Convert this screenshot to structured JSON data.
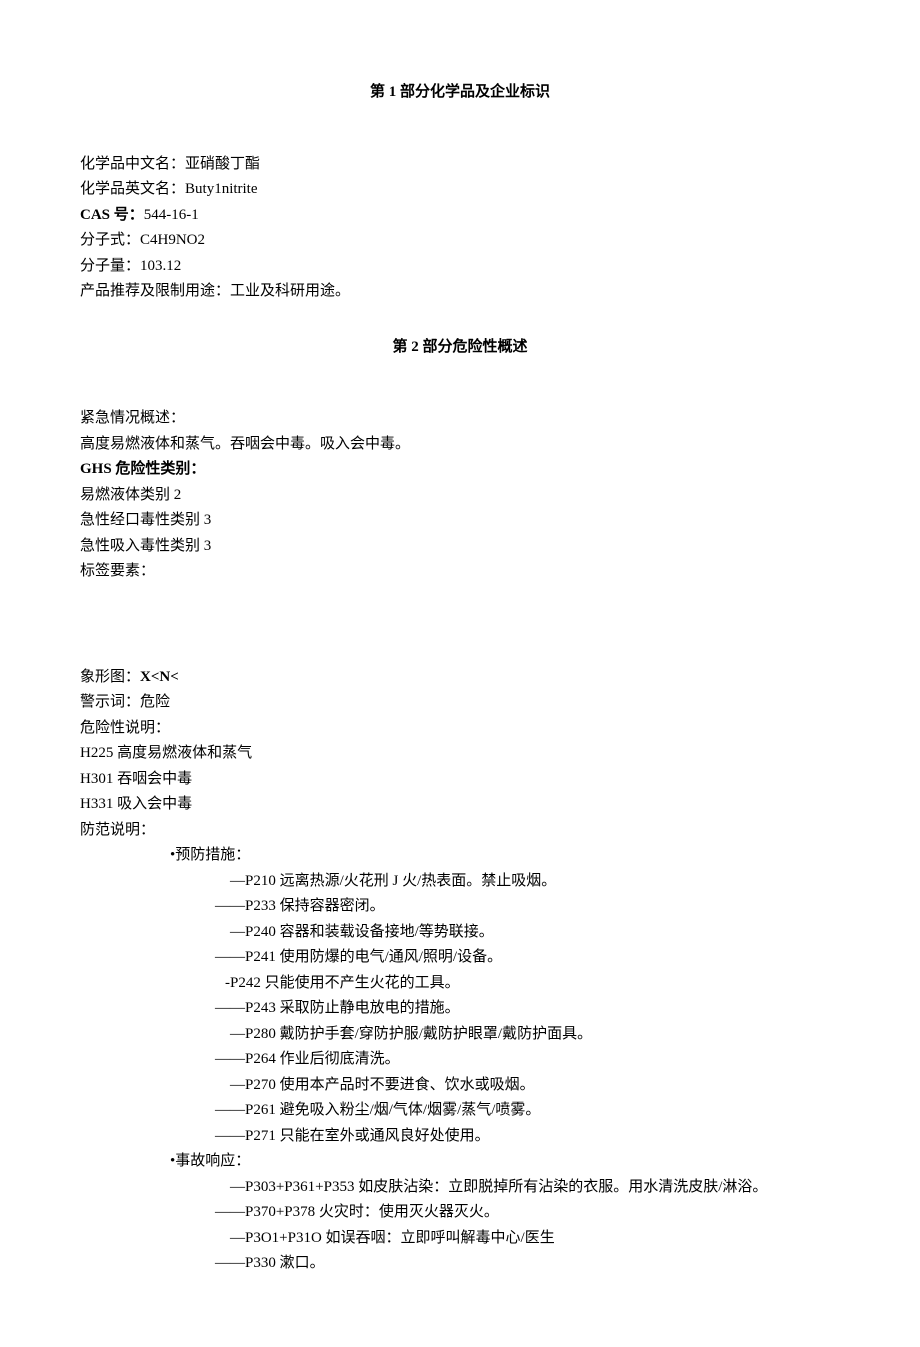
{
  "section1": {
    "title": "第 1 部分化学品及企业标识",
    "name_cn_label": "化学品中文名：",
    "name_cn": "亚硝酸丁酯",
    "name_en_label": "化学品英文名：",
    "name_en": "Buty1nitrite",
    "cas_label": "CAS 号：",
    "cas": "544-16-1",
    "formula_label": "分子式：",
    "formula": "C4H9NO2",
    "weight_label": "分子量：",
    "weight": "103.12",
    "usage_label": "产品推荐及限制用途：",
    "usage": "工业及科研用途。"
  },
  "section2": {
    "title": "第 2 部分危险性概述",
    "emergency_label": "紧急情况概述：",
    "emergency": "高度易燃液体和蒸气。吞咽会中毒。吸入会中毒。",
    "ghs_label": "GHS 危险性类别：",
    "ghs1": "易燃液体类别 2",
    "ghs2": "急性经口毒性类别 3",
    "ghs3": "急性吸入毒性类别 3",
    "label_elements": "标签要素：",
    "pictogram_label": "象形图：",
    "pictogram": "X<N<",
    "signal_label": "警示词：",
    "signal": "危险",
    "hazard_label": "危险性说明：",
    "h225": "H225 高度易燃液体和蒸气",
    "h301": "H301 吞咽会中毒",
    "h331": "H331 吸入会中毒",
    "precaution_label": "防范说明：",
    "prevent_label": "•预防措施：",
    "p210": "—P210 远离热源/火花刑 J 火/热表面。禁止吸烟。",
    "p233": "——P233 保持容器密闭。",
    "p240": "—P240 容器和装载设备接地/等势联接。",
    "p241": "——P241 使用防爆的电气/通风/照明/设备。",
    "p242": "-P242 只能使用不产生火花的工具。",
    "p243": "——P243 采取防止静电放电的措施。",
    "p280": "—P280 戴防护手套/穿防护服/戴防护眼罩/戴防护面具。",
    "p264": "——P264 作业后彻底清洗。",
    "p270": "—P270 使用本产品时不要进食、饮水或吸烟。",
    "p261": "——P261 避免吸入粉尘/烟/气体/烟雾/蒸气/喷雾。",
    "p271": "——P271 只能在室外或通风良好处使用。",
    "response_label": "•事故响应：",
    "p303": "—P303+P361+P353 如皮肤沾染：立即脱掉所有沾染的衣服。用水清洗皮肤/淋浴。",
    "p370": "——P370+P378 火灾时：使用灭火器灭火。",
    "p301": "—P3O1+P31O 如误吞咽：立即呼叫解毒中心/医生",
    "p330": "——P330 漱口。"
  }
}
